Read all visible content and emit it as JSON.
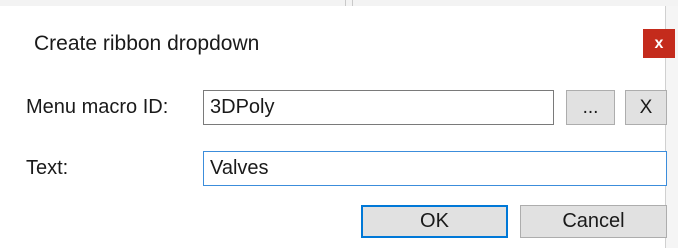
{
  "dialog": {
    "title": "Create ribbon dropdown",
    "close_label": "x",
    "accent_color": "#c42b1c"
  },
  "form": {
    "macro_id": {
      "label": "Menu macro ID:",
      "value": "3DPoly",
      "browse_label": "...",
      "clear_label": "X"
    },
    "text": {
      "label": "Text:",
      "value": "Valves"
    }
  },
  "buttons": {
    "ok_label": "OK",
    "cancel_label": "Cancel"
  }
}
